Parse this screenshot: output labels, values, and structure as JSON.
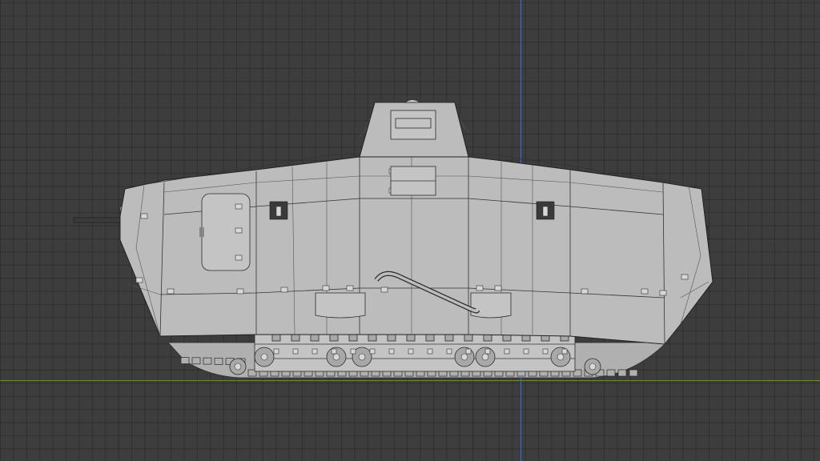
{
  "viewport": {
    "view_mode": "orthographic-side",
    "grid": true,
    "colors": {
      "background": "#3d3d3d",
      "grid_line": "#2f2f2f",
      "axis_vertical": "#4a6fb0",
      "axis_horizontal": "#6a8a3a",
      "model_fill": "#c0c0c0",
      "model_edge": "#222222"
    }
  },
  "model": {
    "subject": "tank-hull-side-view",
    "display": "solid-with-wireframe"
  }
}
